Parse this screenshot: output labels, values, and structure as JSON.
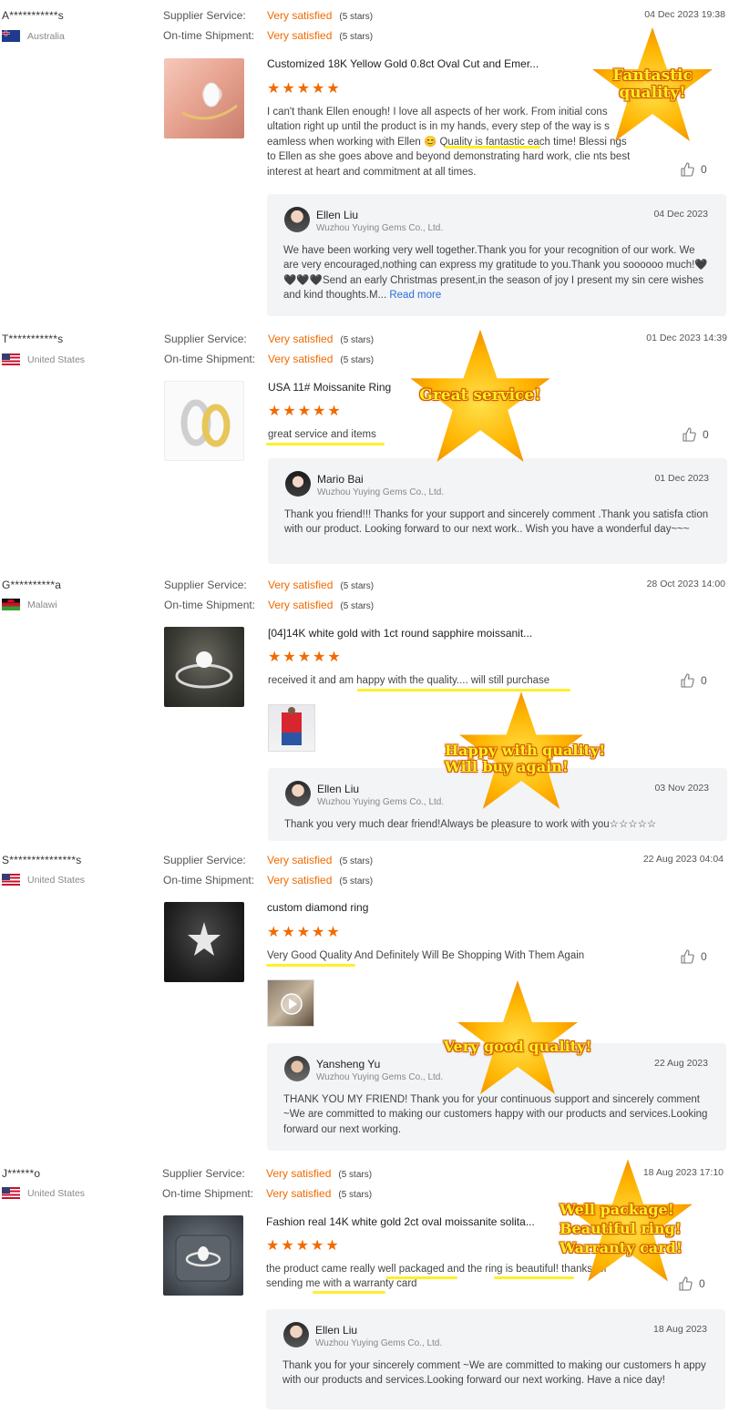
{
  "labels": {
    "supplier_service": "Supplier Service:",
    "on_time_shipment": "On-time Shipment:",
    "read_more": "Read more"
  },
  "colors": {
    "accent_orange": "#f16a00",
    "highlight_yellow": "#ffef2a",
    "badge_text": "#ffee22",
    "link_blue": "#2b6fd6"
  },
  "reviews": [
    {
      "buyer": "A***********s",
      "country": "Australia",
      "flag_icon": "australia-flag-icon",
      "supplier_service": "Very satisfied",
      "supplier_service_stars": "(5 stars)",
      "shipment": "Very satisfied",
      "shipment_stars": "(5 stars)",
      "date": "04 Dec 2023 19:38",
      "product_title": "Customized 18K Yellow Gold 0.8ct Oval Cut and Emer...",
      "rating": 5,
      "text": "I can't thank Ellen enough! I love all aspects of her work. From initial cons ultation right up until the product is in my hands, every step of the way is s eamless when working with Ellen 😊 Quality is fantastic each time! Blessi ngs to Ellen as she goes above and beyond demonstrating hard work, clie nts best interest at heart and commitment at all times.",
      "likes": "0",
      "reply": {
        "name": "Ellen Liu",
        "company": "Wuzhou Yuying Gems Co., Ltd.",
        "date": "04 Dec 2023",
        "text": "We have been working very well together.Thank you for your recognition of our work. We are very encouraged,nothing can express my gratitude to you.Thank you soooooo much!🖤🖤🖤🖤Send an early Christmas present,in the season of joy I present my sin cere wishes and kind thoughts.M..."
      },
      "badge": "Fantastic\nquality!"
    },
    {
      "buyer": "T***********s",
      "country": "United States",
      "flag_icon": "usa-flag-icon",
      "supplier_service": "Very satisfied",
      "supplier_service_stars": "(5 stars)",
      "shipment": "Very satisfied",
      "shipment_stars": "(5 stars)",
      "date": "01 Dec 2023 14:39",
      "product_title": "USA 11# Moissanite Ring",
      "rating": 5,
      "text": "great service and items",
      "likes": "0",
      "reply": {
        "name": "Mario Bai",
        "company": "Wuzhou Yuying Gems Co., Ltd.",
        "date": "01 Dec 2023",
        "text": "Thank you friend!!! Thanks for your support and sincerely comment .Thank you satisfa ction with our product. Looking forward to our next work.. Wish you have a wonderful day~~~"
      },
      "badge": "Great service!"
    },
    {
      "buyer": "G**********a",
      "country": "Malawi",
      "flag_icon": "malawi-flag-icon",
      "supplier_service": "Very satisfied",
      "supplier_service_stars": "(5 stars)",
      "shipment": "Very satisfied",
      "shipment_stars": "(5 stars)",
      "date": "28 Oct 2023 14:00",
      "product_title": "[04]14K white gold with 1ct round sapphire moissanit...",
      "rating": 5,
      "text": "received it and am happy with the quality.... will still purchase",
      "likes": "0",
      "reply": {
        "name": "Ellen Liu",
        "company": "Wuzhou Yuying Gems Co., Ltd.",
        "date": "03 Nov 2023",
        "text": "Thank you very much dear friend!Always be pleasure to work with you☆☆☆☆☆"
      },
      "badge": "Happy with quality!\nWill buy again!"
    },
    {
      "buyer": "S***************s",
      "country": "United States",
      "flag_icon": "usa-flag-icon",
      "supplier_service": "Very satisfied",
      "supplier_service_stars": "(5 stars)",
      "shipment": "Very satisfied",
      "shipment_stars": "(5 stars)",
      "date": "22 Aug 2023 04:04",
      "product_title": "custom diamond ring",
      "rating": 5,
      "text": "Very Good Quality And Definitely Will Be Shopping With Them Again",
      "likes": "0",
      "reply": {
        "name": "Yansheng Yu",
        "company": "Wuzhou Yuying Gems Co., Ltd.",
        "date": "22 Aug 2023",
        "text": "THANK YOU MY FRIEND! Thank you for your continuous support and sincerely comment ~We are committed to making our customers happy with our products and services.Looking forward our next working."
      },
      "badge": "Very good quality!"
    },
    {
      "buyer": "J******o",
      "country": "United States",
      "flag_icon": "usa-flag-icon",
      "supplier_service": "Very satisfied",
      "supplier_service_stars": "(5 stars)",
      "shipment": "Very satisfied",
      "shipment_stars": "(5 stars)",
      "date": "18 Aug 2023 17:10",
      "product_title": "Fashion real 14K white gold 2ct oval moissanite solita...",
      "rating": 5,
      "text": "the product came really well packaged and the ring is beautiful! thanks for sending me with a warranty card",
      "likes": "0",
      "reply": {
        "name": "Ellen Liu",
        "company": "Wuzhou Yuying Gems Co., Ltd.",
        "date": "18 Aug 2023",
        "text": "Thank you for your sincerely comment ~We are committed to making our customers h appy with our products and services.Looking forward our next working. Have a nice day!"
      },
      "badge": "Well package!\nBeautiful ring!\nWarranty card!"
    }
  ]
}
